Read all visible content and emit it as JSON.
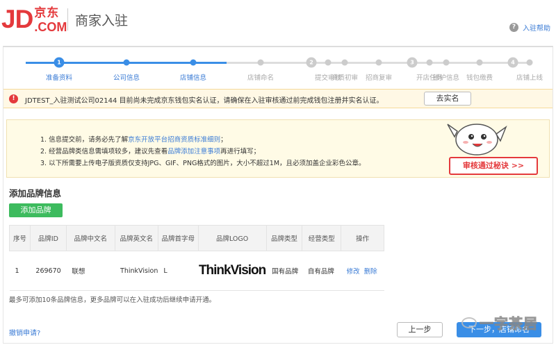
{
  "header": {
    "logo_jd": "JD",
    "logo_cn": "京东",
    "logo_com": ".COM",
    "title": "商家入驻",
    "help_label": "入驻帮助",
    "help_icon": "question-circle"
  },
  "steps": [
    {
      "label": "准备资料",
      "state": "active",
      "marker": "1"
    },
    {
      "label": "公司信息",
      "state": "active",
      "marker": ""
    },
    {
      "label": "店铺信息",
      "state": "active",
      "marker": ""
    },
    {
      "label": "店铺命名",
      "state": "inactive",
      "marker": ""
    },
    {
      "label": "",
      "state": "inactive",
      "marker": "2"
    },
    {
      "label": "提交审核",
      "state": "inactive",
      "marker": ""
    },
    {
      "label": "资质初审",
      "state": "inactive",
      "marker": ""
    },
    {
      "label": "招商复审",
      "state": "inactive",
      "marker": ""
    },
    {
      "label": "",
      "state": "inactive",
      "marker": "3"
    },
    {
      "label": "开店任务",
      "state": "inactive",
      "marker": ""
    },
    {
      "label": "维护信息",
      "state": "inactive",
      "marker": ""
    },
    {
      "label": "钱包缴费",
      "state": "inactive",
      "marker": ""
    },
    {
      "label": "",
      "state": "inactive",
      "marker": "4"
    },
    {
      "label": "店铺上线",
      "state": "inactive",
      "marker": ""
    }
  ],
  "alert": {
    "text": "JDTEST_入驻测试公司02144 目前尚未完成京东钱包实名认证，请确保在入驻审核通过前完成钱包注册并实名认证。",
    "button": "去实名"
  },
  "tips": {
    "line1_pre": "1. 信息提交前，请务必先了解",
    "line1_link": "京东开放平台招商资质标准细则",
    "line1_post": "；",
    "line2_pre": "2. 经营品牌类信息需填项较多，建议先查看",
    "line2_link": "品牌添加注意事项",
    "line2_post": "再进行填写；",
    "line3": "3. 以下所需要上传电子版资质仅支持JPG、GIF、PNG格式的图片，大小不超过1M，且必须加盖企业彩色公章。",
    "audit_button": "审核通过秘诀 >>"
  },
  "brand_section": {
    "title": "添加品牌信息",
    "add_button": "添加品牌",
    "columns": [
      "序号",
      "品牌ID",
      "品牌中文名",
      "品牌英文名",
      "品牌首字母",
      "品牌LOGO",
      "品牌类型",
      "经营类型",
      "操作"
    ],
    "rows": [
      {
        "index": "1",
        "brand_id": "269670",
        "name_cn": "联想",
        "name_en": "ThinkVision",
        "initial": "L",
        "logo_text": "ThinkVision",
        "brand_type": "国有品牌",
        "business_type": "自有品牌",
        "edit": "修改",
        "delete": "删除"
      }
    ],
    "note": "最多可添加10条品牌信息，更多品牌可以在入驻成功后继续申请开通。"
  },
  "footer": {
    "cancel_link": "撤销申请?",
    "prev_button": "上一步",
    "next_button": "下一步，店铺命名"
  },
  "watermark": {
    "text": "一字茶居"
  },
  "colors": {
    "brand_red": "#e4393c",
    "accent_blue": "#3a8ee6",
    "green": "#3dbb5e"
  }
}
